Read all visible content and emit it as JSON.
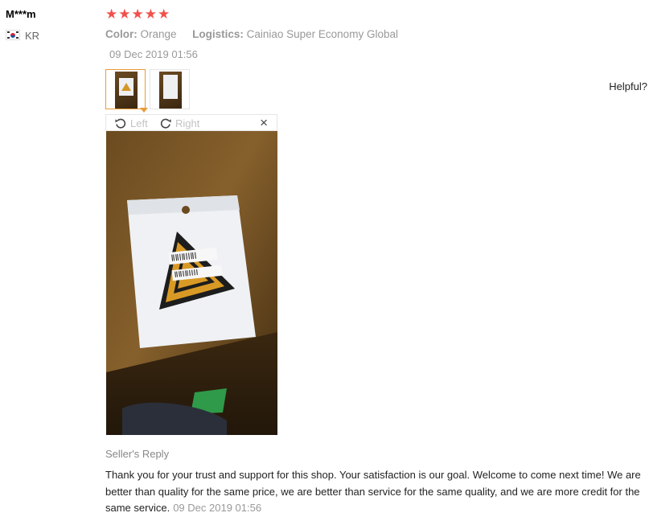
{
  "review": {
    "user": "M***m",
    "country": "KR",
    "rating": 5,
    "stars": [
      "★",
      "★",
      "★",
      "★",
      "★"
    ],
    "color_label": "Color:",
    "color_value": "Orange",
    "logistics_label": "Logistics:",
    "logistics_value": "Cainiao Super Economy Global",
    "date": "09 Dec 2019 01:56",
    "helpful": "Helpful?"
  },
  "viewer": {
    "rotate_left": "Left",
    "rotate_right": "Right",
    "close": "×"
  },
  "seller_reply": {
    "title": "Seller's Reply",
    "text": "Thank you for your trust and support for this shop. Your satisfaction is our goal. Welcome to come next time! We are better than quality for the same price, we are better than service for the same quality, and we are more credit for the same service.",
    "date": "09 Dec 2019 01:56"
  },
  "colors": {
    "star": "#f2504b",
    "thumb_active_border": "#e89b38",
    "muted_text": "#999999"
  }
}
